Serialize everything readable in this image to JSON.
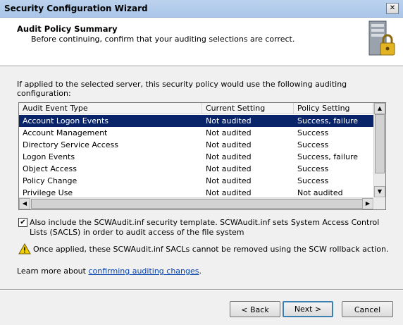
{
  "window": {
    "title": "Security Configuration Wizard",
    "close_glyph": "✕"
  },
  "header": {
    "title": "Audit Policy Summary",
    "subtitle": "Before continuing, confirm that your auditing selections are correct."
  },
  "intro": "If applied to the selected server, this security policy would use the following auditing configuration:",
  "table": {
    "columns": [
      "Audit Event Type",
      "Current Setting",
      "Policy Setting"
    ],
    "rows": [
      {
        "event": "Account Logon Events",
        "current": "Not audited",
        "policy": "Success, failure",
        "selected": true
      },
      {
        "event": "Account Management",
        "current": "Not audited",
        "policy": "Success"
      },
      {
        "event": "Directory Service Access",
        "current": "Not audited",
        "policy": "Success"
      },
      {
        "event": "Logon Events",
        "current": "Not audited",
        "policy": "Success, failure"
      },
      {
        "event": "Object Access",
        "current": "Not audited",
        "policy": "Success"
      },
      {
        "event": "Policy Change",
        "current": "Not audited",
        "policy": "Success"
      },
      {
        "event": "Privilege Use",
        "current": "Not audited",
        "policy": "Not audited"
      }
    ]
  },
  "include_template": {
    "checked": true,
    "label": "Also include the SCWAudit.inf security template. SCWAudit.inf sets System Access Control Lists (SACLS) in order to audit access of the file system"
  },
  "warning": {
    "icon": "warning-icon",
    "text": "Once applied, these SCWAudit.inf SACLs cannot be removed using the SCW rollback action."
  },
  "learn_more": {
    "prefix": "Learn more about ",
    "link": "confirming auditing changes",
    "suffix": "."
  },
  "buttons": {
    "back": "< Back",
    "next": "Next >",
    "cancel": "Cancel"
  },
  "colors": {
    "selection": "#0a246a",
    "link": "#0645ad",
    "title_bar": "#bcd3ee"
  }
}
